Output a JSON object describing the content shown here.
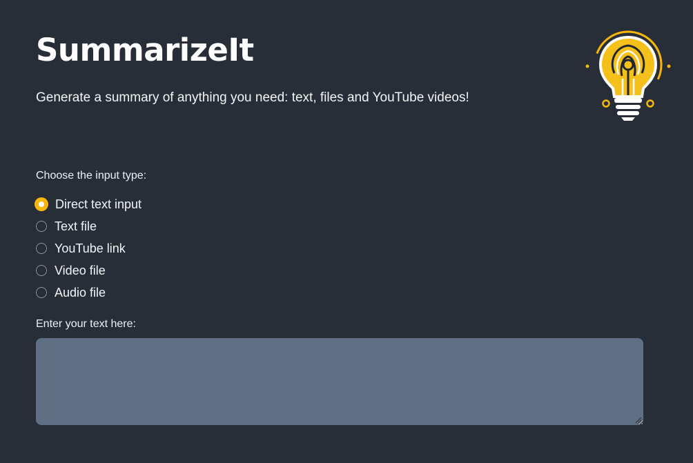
{
  "app": {
    "title": "SummarizeIt",
    "subtitle": "Generate a summary of anything you need: text, files and YouTube videos!",
    "logo_icon": "lightbulb-icon",
    "accent_color": "#f5b70a"
  },
  "input_type": {
    "label": "Choose the input type:",
    "selected": "Direct text input",
    "options": [
      {
        "label": "Direct text input",
        "selected": true
      },
      {
        "label": "Text file",
        "selected": false
      },
      {
        "label": "YouTube link",
        "selected": false
      },
      {
        "label": "Video file",
        "selected": false
      },
      {
        "label": "Audio file",
        "selected": false
      }
    ]
  },
  "text_input": {
    "label": "Enter your text here:",
    "value": "",
    "placeholder": ""
  }
}
